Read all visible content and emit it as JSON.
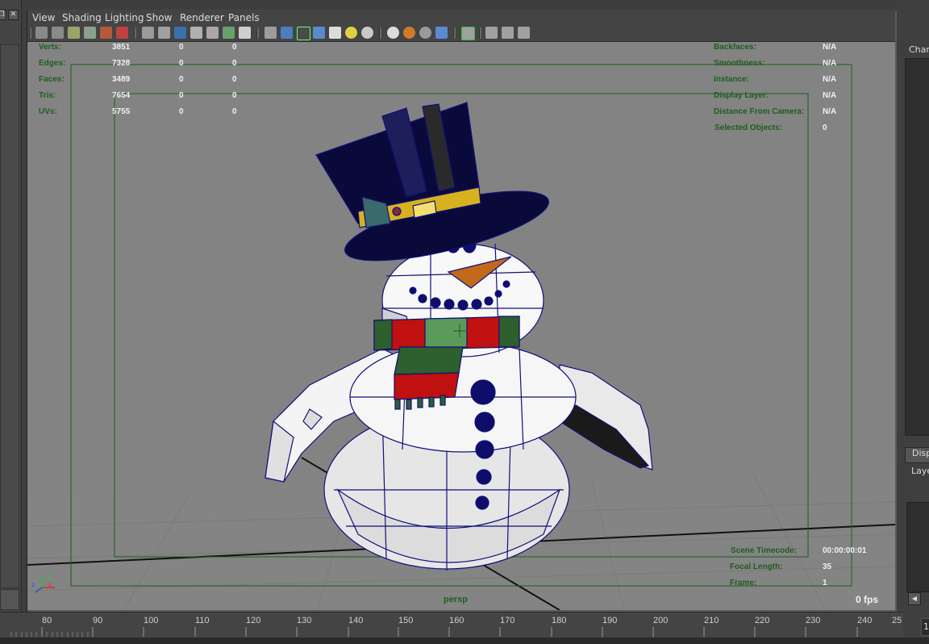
{
  "menu": [
    "View",
    "Shading",
    "Lighting",
    "Show",
    "Renderer",
    "Panels"
  ],
  "window_controls": {
    "restore": "❐",
    "close": "✕"
  },
  "hud_left": [
    {
      "label": "Verts:",
      "v1": "3851",
      "v2": "0",
      "v3": "0"
    },
    {
      "label": "Edges:",
      "v1": "7328",
      "v2": "0",
      "v3": "0"
    },
    {
      "label": "Faces:",
      "v1": "3489",
      "v2": "0",
      "v3": "0"
    },
    {
      "label": "Tris:",
      "v1": "7654",
      "v2": "0",
      "v3": "0"
    },
    {
      "label": "UVs:",
      "v1": "5755",
      "v2": "0",
      "v3": "0"
    }
  ],
  "hud_right": [
    {
      "label": "Backfaces:",
      "value": "N/A"
    },
    {
      "label": "Smoothness:",
      "value": "N/A"
    },
    {
      "label": "Instance:",
      "value": "N/A"
    },
    {
      "label": "Display Layer:",
      "value": "N/A"
    },
    {
      "label": "Distance From Camera:",
      "value": "N/A"
    },
    {
      "label": "Selected Objects:",
      "value": "0"
    }
  ],
  "hud_bottom": [
    {
      "label": "Scene Timecode:",
      "value": "00:00:00:01"
    },
    {
      "label": "Focal Length:",
      "value": "35"
    },
    {
      "label": "Frame:",
      "value": "1"
    }
  ],
  "camera_name": "persp",
  "fps": "0 fps",
  "right_panel": {
    "channel_label": "Chan",
    "display_tab": "Disp",
    "layers_label": "Laye",
    "scroll_left": "◀"
  },
  "timeline": {
    "labels": [
      "80",
      "90",
      "100",
      "110",
      "120",
      "130",
      "140",
      "150",
      "160",
      "170",
      "180",
      "190",
      "200",
      "210",
      "220",
      "230",
      "240",
      "25"
    ],
    "current_frame": "1"
  },
  "axis": {
    "x": "x",
    "y": "y",
    "z": "z"
  },
  "colors": {
    "viewport_bg": "#838383",
    "hud_label": "#1f5e1f",
    "hud_value": "#f0f0f0",
    "wireframe": "#10107a",
    "hat": "#0a0a3a",
    "hat_band": "#d8b21e",
    "scarf_red": "#c01010",
    "scarf_green": "#2e5f2e",
    "scarf_light": "#5a9a5a",
    "nose": "#c06a1a",
    "body": "#f2f2f2"
  }
}
